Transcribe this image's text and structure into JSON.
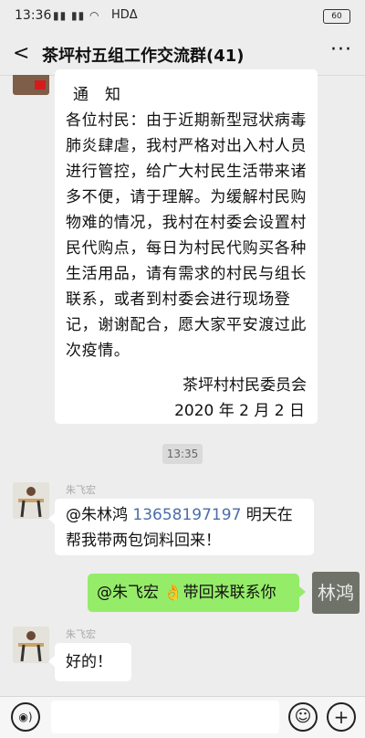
{
  "status": {
    "time": "13:36",
    "signal": "▮▮ ▮▮ ◠",
    "network": "HDΔ",
    "battery": "60"
  },
  "header": {
    "back_glyph": "<",
    "title": "茶坪村五组工作交流群(41)",
    "more_glyph": "···"
  },
  "notice": {
    "title": "通知",
    "body": "各位村民：由于近期新型冠状病毒肺炎肆虐，我村严格对出入村人员进行管控，给广大村民生活带来诸多不便，请于理解。为缓解村民购物难的情况，我村在村委会设置村民代购点，每日为村民代购买各种生活用品，请有需求的村民与组长联系，或者到村委会进行现场登记，谢谢配合，愿大家平安渡过此次疫情。",
    "signature": "茶坪村村民委员会",
    "date": "2020 年 2 月 2 日"
  },
  "timestamp": "13:35",
  "messages": [
    {
      "sender": "朱飞宏",
      "prefix": "@朱林鸿 ",
      "phone": "13658197197",
      "suffix": " 明天在帮我带两包饲料回来！"
    },
    {
      "prefix": "@朱飞宏 ",
      "emoji": "👌",
      "suffix": "带回来联系你",
      "avatar_text": "林鸿"
    },
    {
      "sender": "朱飞宏",
      "text": "好的！"
    }
  ],
  "bottom": {
    "voice_glyph": "◉)",
    "emoji_glyph": "☺",
    "plus_glyph": "+"
  }
}
